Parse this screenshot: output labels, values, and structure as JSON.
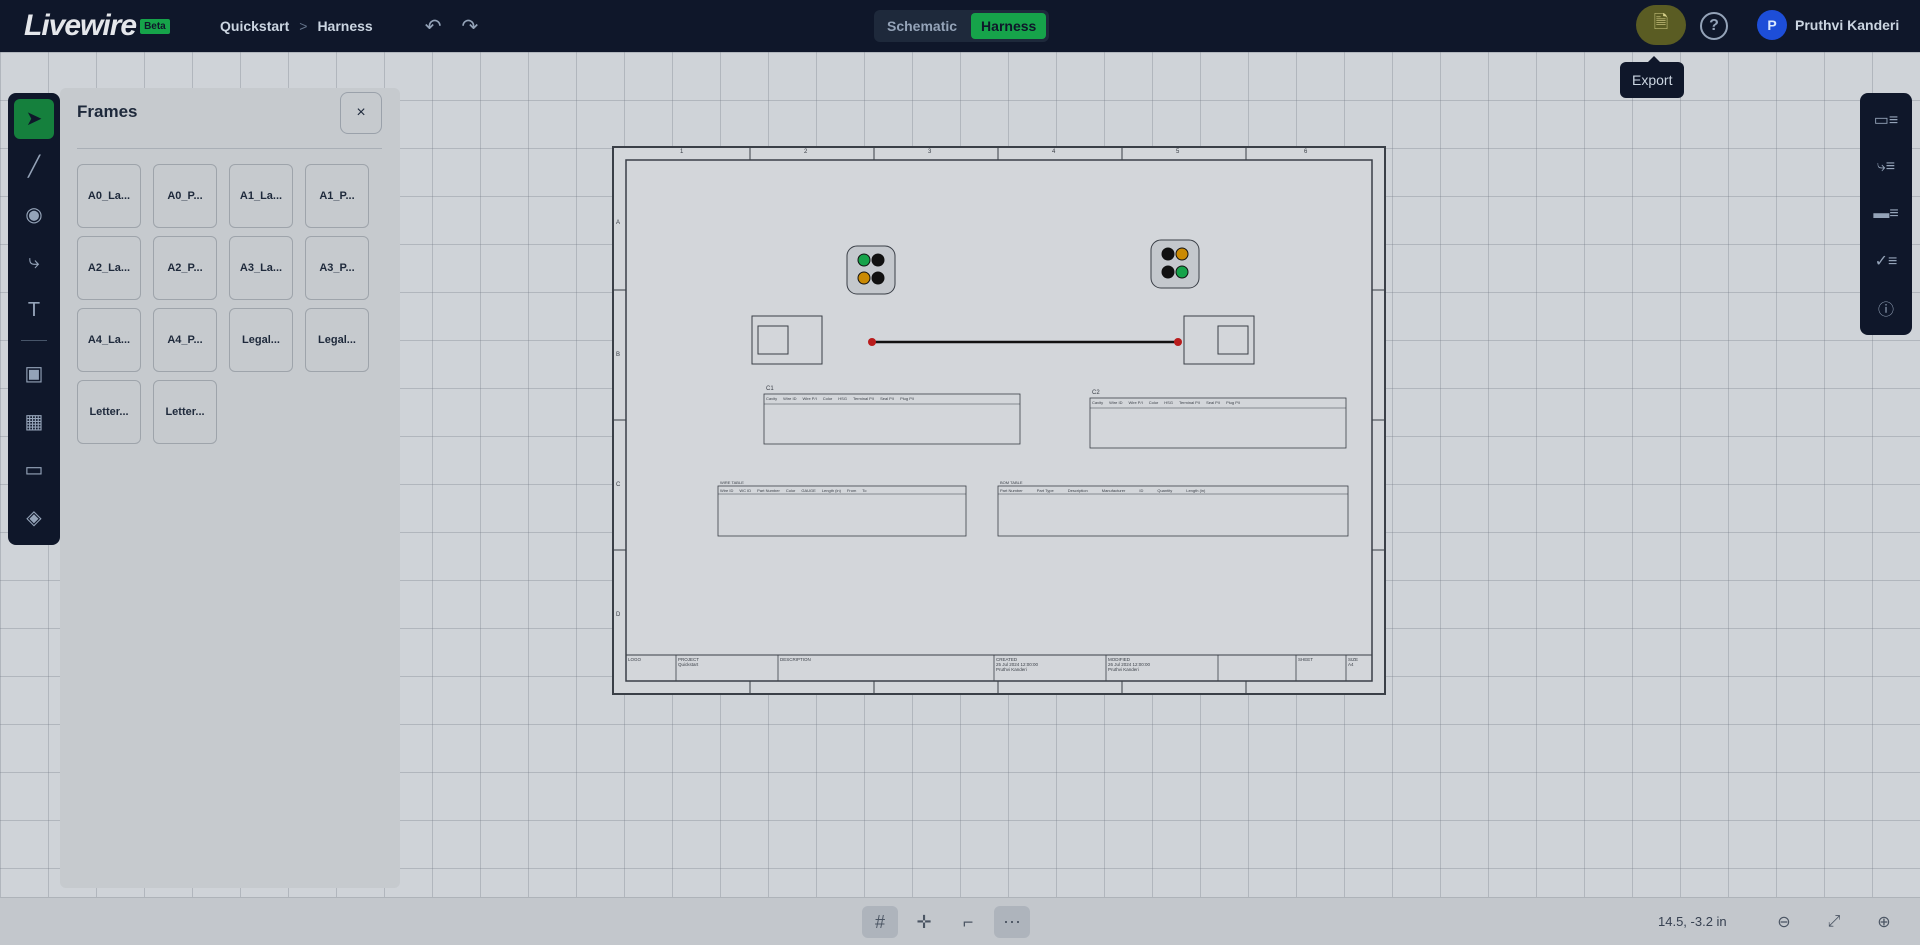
{
  "app": {
    "logo_text": "Livewire",
    "logo_badge": "Beta"
  },
  "breadcrumb": {
    "items": [
      "Quickstart",
      "Harness"
    ],
    "separator": ">"
  },
  "mode_toggle": {
    "options": [
      "Schematic",
      "Harness"
    ],
    "active": "Harness"
  },
  "export": {
    "tooltip": "Export"
  },
  "help": {
    "label": "?"
  },
  "user": {
    "initial": "P",
    "name": "Pruthvi Kanderi"
  },
  "frames_panel": {
    "title": "Frames",
    "close_label": "×",
    "items": [
      "A0_La...",
      "A0_P...",
      "A1_La...",
      "A1_P...",
      "A2_La...",
      "A2_P...",
      "A3_La...",
      "A3_P...",
      "A4_La...",
      "A4_P...",
      "Legal...",
      "Legal...",
      "Letter...",
      "Letter..."
    ]
  },
  "sheet": {
    "col_labels": [
      "1",
      "2",
      "3",
      "4",
      "5",
      "6"
    ],
    "row_labels": [
      "A",
      "B",
      "C",
      "D"
    ],
    "connector_a_label": "C1",
    "connector_b_label": "C2",
    "pin_table_headers": [
      "Cavity",
      "Wire ID",
      "Wire P/I",
      "Color",
      "HSG",
      "Terminal P/I",
      "Seal P/I",
      "Plug P/I"
    ],
    "wire_table_title": "WIRE TABLE",
    "wire_table_headers": [
      "Wire ID",
      "WC ID",
      "Part Number",
      "Color",
      "GAUGE",
      "Length (in)",
      "From",
      "To"
    ],
    "bom_title": "BOM TABLE",
    "bom_headers": [
      "Part Number",
      "Part Type",
      "Description",
      "Manufacturer",
      "ID",
      "Quantity",
      "Length (in)"
    ],
    "title_block": {
      "logo_label": "LOGO",
      "project_label": "PROJECT",
      "project_value": "Quickstart",
      "description_label": "DESCRIPTION",
      "created_label": "CREATED",
      "created_value": "25 Jul 2024 12:00:00",
      "created_by": "Pruthvi Kanderi",
      "modified_label": "MODIFIED",
      "modified_value": "26 Jul 2024 12:00:00",
      "modified_by": "Pruthvi Kanderi",
      "sheet_label": "SHEET",
      "size_label": "SIZE",
      "size_value": "A4"
    }
  },
  "bottom": {
    "coords": "14.5, -3.2 in"
  },
  "colors": {
    "accent": "#16a34a",
    "topbar": "#0f172a",
    "export_highlight": "#ca8a04"
  }
}
